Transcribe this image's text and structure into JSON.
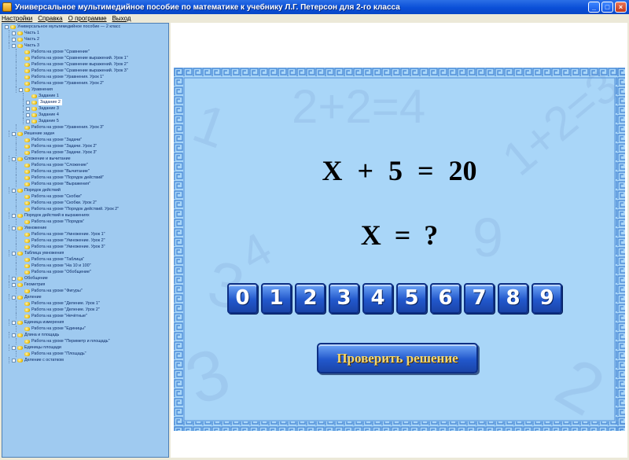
{
  "window": {
    "title": "Универсальное мультимедийное пособие по математике к учебнику Л.Г. Петерсон для 2-го класса",
    "buttons": {
      "minimize": "_",
      "maximize": "□",
      "close": "×"
    }
  },
  "menu": [
    "Настройки",
    "Справка",
    "О программе",
    "Выход"
  ],
  "tree": [
    {
      "label": "Универсальное мультимедийное пособие — 2 класс",
      "indent": 0,
      "expander": true,
      "icon": true
    },
    {
      "label": "Часть 1",
      "indent": 1,
      "expander": true,
      "icon": true
    },
    {
      "label": "Часть 2",
      "indent": 1,
      "expander": true,
      "icon": true
    },
    {
      "label": "Часть 3",
      "indent": 1,
      "expander": true,
      "icon": true
    },
    {
      "label": "Работа на уроке \"Сравнение\"",
      "indent": 2,
      "expander": false,
      "icon": true
    },
    {
      "label": "Работа на уроке \"Сравнение выражений. Урок 1\"",
      "indent": 2,
      "expander": false,
      "icon": true
    },
    {
      "label": "Работа на уроке \"Сравнение выражений. Урок 2\"",
      "indent": 2,
      "expander": false,
      "icon": true
    },
    {
      "label": "Работа на уроке \"Сравнение выражений. Урок 3\"",
      "indent": 2,
      "expander": false,
      "icon": true
    },
    {
      "label": "Работа на уроке \"Уравнения. Урок 1\"",
      "indent": 2,
      "expander": false,
      "icon": true
    },
    {
      "label": "Работа на уроке \"Уравнения. Урок 2\"",
      "indent": 2,
      "expander": false,
      "icon": true
    },
    {
      "label": "Уравнения",
      "indent": 2,
      "expander": true,
      "icon": true
    },
    {
      "label": "Задание 1",
      "indent": 3,
      "expander": false,
      "icon": true
    },
    {
      "label": "Задание 2",
      "indent": 3,
      "expander": true,
      "icon": true,
      "selected": true
    },
    {
      "label": "Задание 3",
      "indent": 3,
      "expander": true,
      "icon": true
    },
    {
      "label": "Задание 4",
      "indent": 3,
      "expander": true,
      "icon": true
    },
    {
      "label": "Задание 5",
      "indent": 3,
      "expander": true,
      "icon": true
    },
    {
      "label": "Работа на уроке \"Уравнения. Урок 3\"",
      "indent": 2,
      "expander": false,
      "icon": true
    },
    {
      "label": "Решение задач",
      "indent": 1,
      "expander": true,
      "icon": true
    },
    {
      "label": "Работа на уроке \"Задачи\"",
      "indent": 2,
      "expander": false,
      "icon": true
    },
    {
      "label": "Работа на уроке \"Задачи. Урок 2\"",
      "indent": 2,
      "expander": false,
      "icon": true
    },
    {
      "label": "Работа на уроке \"Задачи. Урок 3\"",
      "indent": 2,
      "expander": false,
      "icon": true
    },
    {
      "label": "Сложение и вычитание",
      "indent": 1,
      "expander": true,
      "icon": true
    },
    {
      "label": "Работа на уроке \"Сложение\"",
      "indent": 2,
      "expander": false,
      "icon": true
    },
    {
      "label": "Работа на уроке \"Вычитание\"",
      "indent": 2,
      "expander": false,
      "icon": true
    },
    {
      "label": "Работа на уроке \"Порядок действий\"",
      "indent": 2,
      "expander": false,
      "icon": true
    },
    {
      "label": "Работа на уроке \"Выражения\"",
      "indent": 2,
      "expander": false,
      "icon": true
    },
    {
      "label": "Порядок действий",
      "indent": 1,
      "expander": true,
      "icon": true
    },
    {
      "label": "Работа на уроке \"Скобки\"",
      "indent": 2,
      "expander": false,
      "icon": true
    },
    {
      "label": "Работа на уроке \"Скобки. Урок 2\"",
      "indent": 2,
      "expander": false,
      "icon": true
    },
    {
      "label": "Работа на уроке \"Порядок действий. Урок 2\"",
      "indent": 2,
      "expander": false,
      "icon": true
    },
    {
      "label": "Порядок действий в выражениях",
      "indent": 1,
      "expander": true,
      "icon": true
    },
    {
      "label": "Работа на уроке \"Порядок\"",
      "indent": 2,
      "expander": false,
      "icon": true
    },
    {
      "label": "Умножение",
      "indent": 1,
      "expander": true,
      "icon": true
    },
    {
      "label": "Работа на уроке \"Умножение. Урок 1\"",
      "indent": 2,
      "expander": false,
      "icon": true
    },
    {
      "label": "Работа на уроке \"Умножение. Урок 2\"",
      "indent": 2,
      "expander": false,
      "icon": true
    },
    {
      "label": "Работа на уроке \"Умножение. Урок 3\"",
      "indent": 2,
      "expander": false,
      "icon": true
    },
    {
      "label": "Таблица умножения",
      "indent": 1,
      "expander": true,
      "icon": true
    },
    {
      "label": "Работа на уроке \"Таблица\"",
      "indent": 2,
      "expander": false,
      "icon": true
    },
    {
      "label": "Работа на уроке \"На 10 и 100\"",
      "indent": 2,
      "expander": false,
      "icon": true
    },
    {
      "label": "Работа на уроке \"Обобщение\"",
      "indent": 2,
      "expander": false,
      "icon": true
    },
    {
      "label": "Обобщение",
      "indent": 1,
      "expander": true,
      "icon": true
    },
    {
      "label": "Геометрия",
      "indent": 1,
      "expander": true,
      "icon": true
    },
    {
      "label": "Работа на уроке \"Фигуры\"",
      "indent": 2,
      "expander": false,
      "icon": true
    },
    {
      "label": "Деление",
      "indent": 1,
      "expander": true,
      "icon": true
    },
    {
      "label": "Работа на уроке \"Деление. Урок 1\"",
      "indent": 2,
      "expander": false,
      "icon": true
    },
    {
      "label": "Работа на уроке \"Деление. Урок 2\"",
      "indent": 2,
      "expander": false,
      "icon": true
    },
    {
      "label": "Работа на уроке \"Нечётные\"",
      "indent": 2,
      "expander": false,
      "icon": true
    },
    {
      "label": "Единица измерения",
      "indent": 1,
      "expander": true,
      "icon": true
    },
    {
      "label": "Работа на уроке \"Единицы\"",
      "indent": 2,
      "expander": false,
      "icon": true
    },
    {
      "label": "Длина и площадь",
      "indent": 1,
      "expander": true,
      "icon": true
    },
    {
      "label": "Работа на уроке \"Периметр и площадь\"",
      "indent": 2,
      "expander": false,
      "icon": true
    },
    {
      "label": "Единицы площади",
      "indent": 1,
      "expander": true,
      "icon": true
    },
    {
      "label": "Работа на уроке \"Площадь\"",
      "indent": 2,
      "expander": false,
      "icon": true
    },
    {
      "label": "Деление с остатком",
      "indent": 1,
      "expander": true,
      "icon": true
    }
  ],
  "exercise": {
    "equation": "X + 5 = 20",
    "question": "X = ?",
    "digits": [
      "0",
      "1",
      "2",
      "3",
      "4",
      "5",
      "6",
      "7",
      "8",
      "9"
    ],
    "check_button": "Проверить решение"
  },
  "colors": {
    "board_bg": "#a9d6f8",
    "tree_bg": "#9fcaf0",
    "button_blue": "#2258cc",
    "button_text": "#f5d76a"
  }
}
